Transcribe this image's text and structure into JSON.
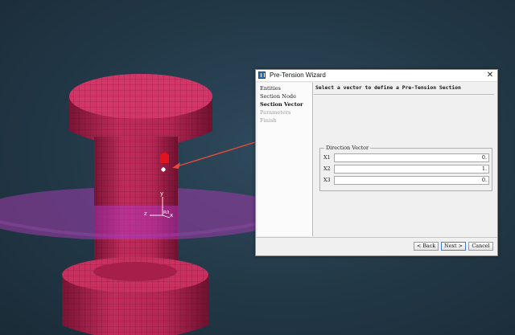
{
  "wizard": {
    "title": "Pre-Tension Wizard",
    "close_glyph": "✕",
    "steps": [
      {
        "label": "Entities",
        "state": "done"
      },
      {
        "label": "Section Node",
        "state": "done"
      },
      {
        "label": "Section Vector",
        "state": "current"
      },
      {
        "label": "Parameters",
        "state": "future"
      },
      {
        "label": "Finish",
        "state": "future"
      }
    ],
    "prompt": "Select a vector to define a Pre-Tension Section",
    "direction_vector": {
      "legend": "Direction Vector",
      "rows": [
        {
          "label": "X1",
          "value": "0."
        },
        {
          "label": "X2",
          "value": "1."
        },
        {
          "label": "X3",
          "value": "0."
        }
      ]
    },
    "buttons": {
      "back": "< Back",
      "next": "Next >",
      "cancel": "Cancel"
    }
  },
  "viewport": {
    "triad_labels": {
      "y": "y",
      "z": "z",
      "x": "x",
      "origin": "R0"
    },
    "model_color": "#c62b5c",
    "plane_color": "#8f3f9f",
    "arrow_color": "#e54b3a",
    "background": "#263f50"
  },
  "icons": {
    "app": "app-icon",
    "close": "close-icon"
  }
}
